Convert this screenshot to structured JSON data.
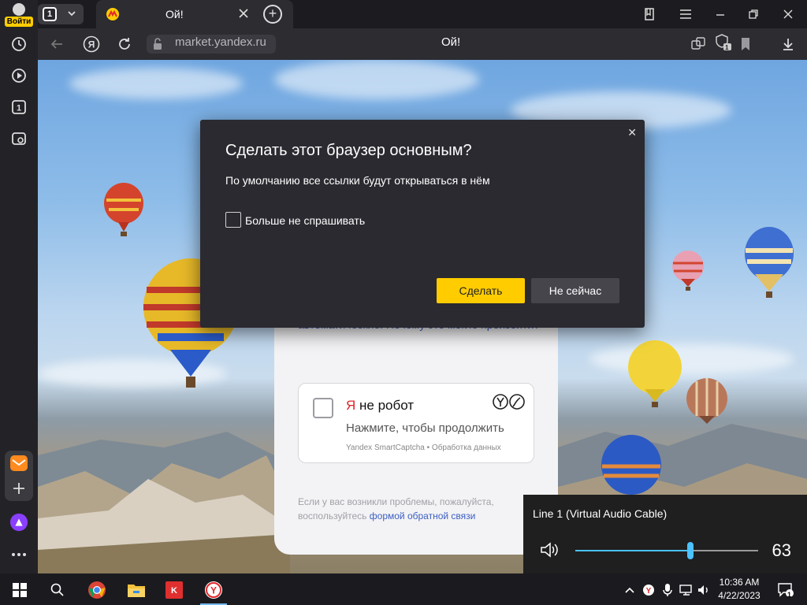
{
  "rail": {
    "login_label": "Войти"
  },
  "tabs": {
    "count": "1",
    "active_title": "Ой!"
  },
  "addressbar": {
    "url": "market.yandex.ru",
    "page_title": "Ой!",
    "downloads_badge": "1"
  },
  "page": {
    "why_text": "автоматические. Почему это могло произойти?",
    "captcha": {
      "ya": "Я",
      "title_rest": " не робот",
      "subtitle": "Нажмите, чтобы продолжить",
      "footer": "Yandex SmartCaptcha • Обработка данных"
    },
    "help_prefix": "Если у вас возникли проблемы, пожалуйста, воспользуйтесь ",
    "help_link": "формой обратной связи"
  },
  "dialog": {
    "title": "Сделать этот браузер основным?",
    "subtitle": "По умолчанию все ссылки будут открываться в нём",
    "checkbox_label": "Больше не спрашивать",
    "confirm_label": "Сделать",
    "cancel_label": "Не сейчас"
  },
  "volume": {
    "device": "Line 1 (Virtual Audio Cable)",
    "value": "63",
    "level_percent": 63
  },
  "taskbar": {
    "time": "10:36 AM",
    "date": "4/22/2023",
    "notification_count": "1"
  },
  "colors": {
    "accent_yellow": "#ffcc00",
    "volume_blue": "#4cc2ff",
    "link_blue": "#3b5ec2",
    "yandex_red": "#e0282b"
  }
}
